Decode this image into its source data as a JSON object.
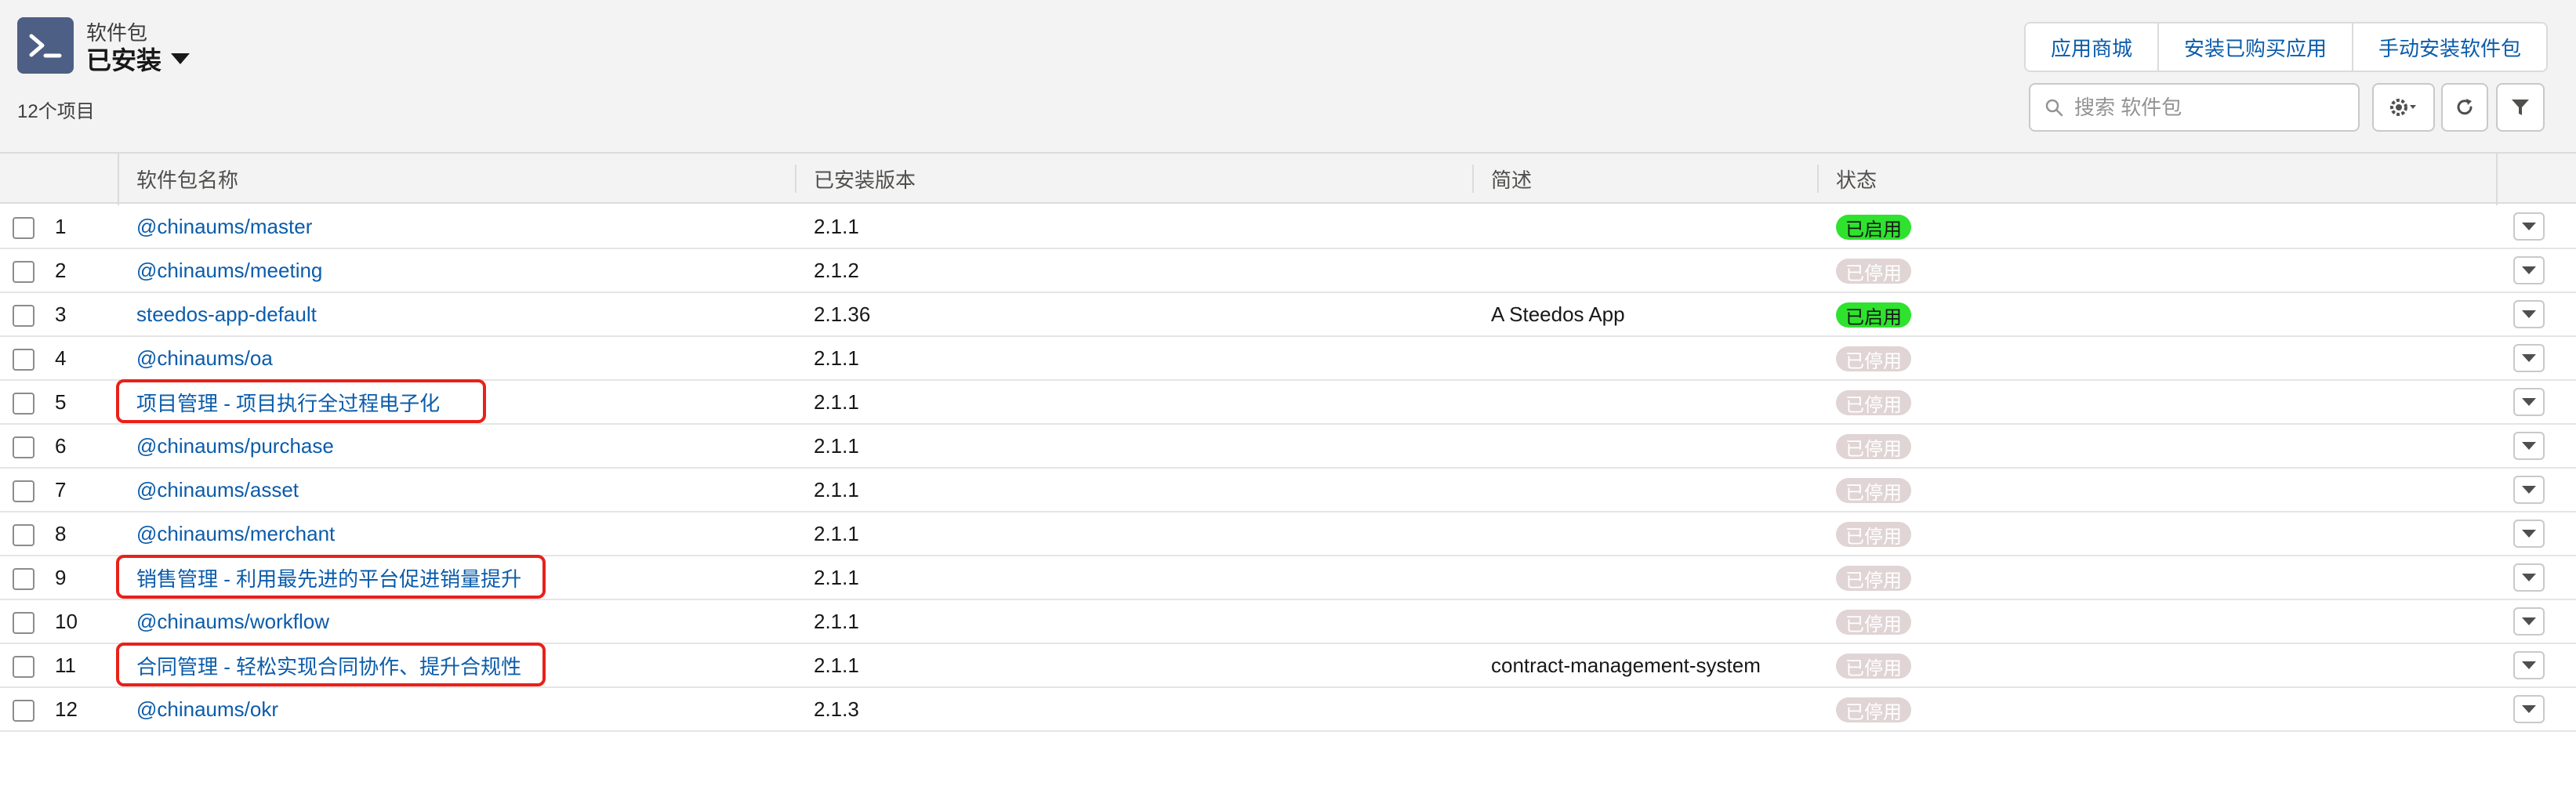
{
  "header": {
    "object_label": "软件包",
    "view_name": "已安装",
    "item_count": "12个项目",
    "app_icon": "terminal-icon",
    "buttons": {
      "app_store": "应用商城",
      "install_purchased": "安装已购买应用",
      "manual_install": "手动安装软件包"
    },
    "search_placeholder": "搜索 软件包",
    "icons": [
      "search-icon",
      "gear-icon",
      "refresh-icon",
      "filter-icon"
    ]
  },
  "table": {
    "columns": {
      "name": "软件包名称",
      "version": "已安装版本",
      "description": "简述",
      "status": "状态"
    },
    "rows": [
      {
        "num": "1",
        "name": "@chinaums/master",
        "version": "2.1.1",
        "description": "",
        "status": "已启用",
        "enabled": true
      },
      {
        "num": "2",
        "name": "@chinaums/meeting",
        "version": "2.1.2",
        "description": "",
        "status": "已停用",
        "enabled": false
      },
      {
        "num": "3",
        "name": "steedos-app-default",
        "version": "2.1.36",
        "description": "A Steedos App",
        "status": "已启用",
        "enabled": true
      },
      {
        "num": "4",
        "name": "@chinaums/oa",
        "version": "2.1.1",
        "description": "",
        "status": "已停用",
        "enabled": false
      },
      {
        "num": "5",
        "name": "项目管理 - 项目执行全过程电子化",
        "version": "2.1.1",
        "description": "",
        "status": "已停用",
        "enabled": false,
        "highlighted": true
      },
      {
        "num": "6",
        "name": "@chinaums/purchase",
        "version": "2.1.1",
        "description": "",
        "status": "已停用",
        "enabled": false
      },
      {
        "num": "7",
        "name": "@chinaums/asset",
        "version": "2.1.1",
        "description": "",
        "status": "已停用",
        "enabled": false
      },
      {
        "num": "8",
        "name": "@chinaums/merchant",
        "version": "2.1.1",
        "description": "",
        "status": "已停用",
        "enabled": false
      },
      {
        "num": "9",
        "name": "销售管理 - 利用最先进的平台促进销量提升",
        "version": "2.1.1",
        "description": "",
        "status": "已停用",
        "enabled": false,
        "highlighted": true
      },
      {
        "num": "10",
        "name": "@chinaums/workflow",
        "version": "2.1.1",
        "description": "",
        "status": "已停用",
        "enabled": false
      },
      {
        "num": "11",
        "name": "合同管理 - 轻松实现合同协作、提升合规性",
        "version": "2.1.1",
        "description": "contract-management-system",
        "status": "已停用",
        "enabled": false,
        "highlighted": true
      },
      {
        "num": "12",
        "name": "@chinaums/okr",
        "version": "2.1.3",
        "description": "",
        "status": "已停用",
        "enabled": false
      }
    ]
  },
  "colors": {
    "brand_link": "#0b5cab",
    "status_enabled": "#2ee22e",
    "status_disabled": "#e0d4d4",
    "highlight_box": "#e8211a"
  }
}
